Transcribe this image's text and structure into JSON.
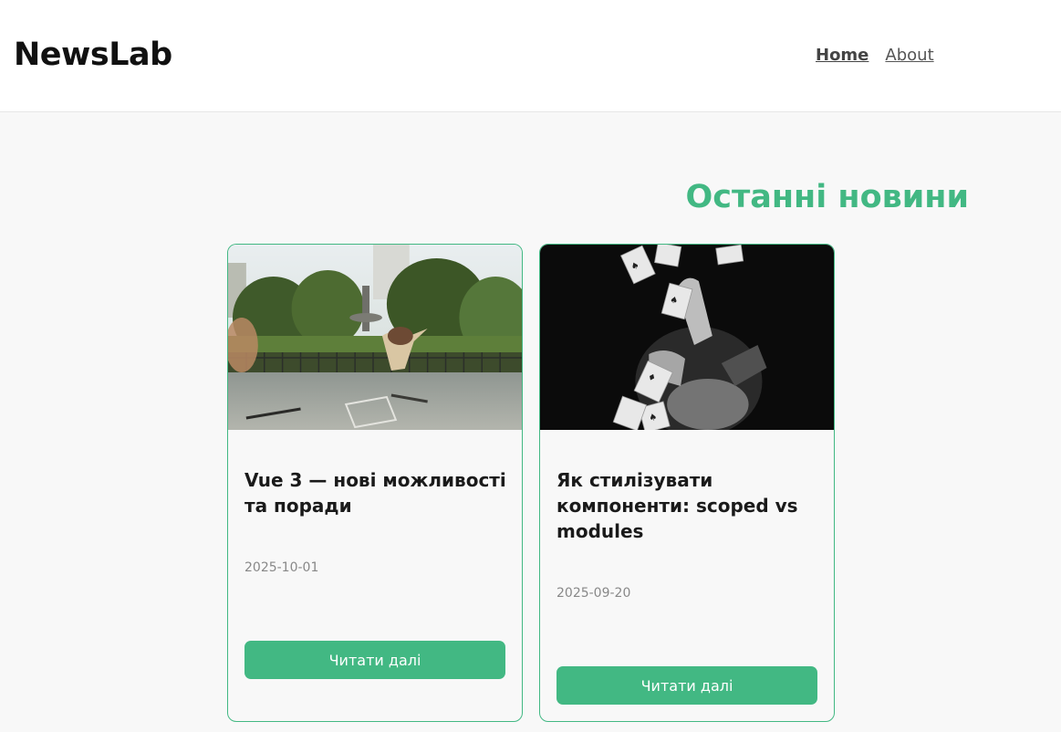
{
  "header": {
    "logo": "NewsLab",
    "nav": [
      {
        "label": "Home",
        "active": true
      },
      {
        "label": "About",
        "active": false
      }
    ]
  },
  "main": {
    "title": "Останні новини",
    "articles": [
      {
        "image": "park-skateboard-photo",
        "title": "Vue 3 — нові можливості та поради",
        "date": "2025-10-01",
        "button": "Читати далі"
      },
      {
        "image": "playing-cards-photo",
        "title": "Як стилізувати компоненти: scoped vs modules",
        "date": "2025-09-20",
        "button": "Читати далі"
      }
    ]
  },
  "colors": {
    "accent": "#42b883",
    "background": "#f8f8f8",
    "header_bg": "#ffffff"
  }
}
